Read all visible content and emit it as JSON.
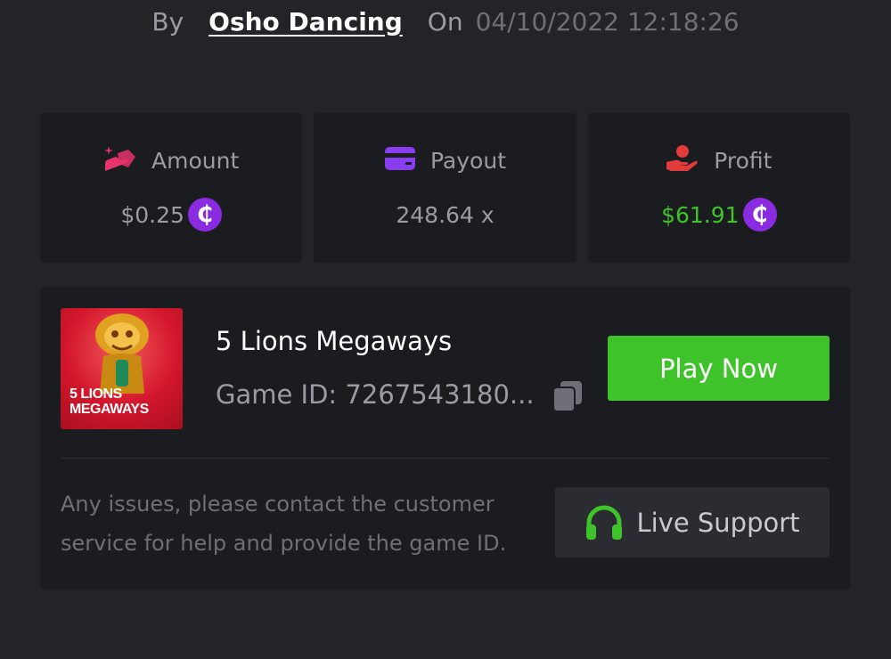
{
  "meta": {
    "by_label": "By",
    "username": "Osho Dancing",
    "on_label": "On",
    "timestamp": "04/10/2022 12:18:26"
  },
  "stats": {
    "amount": {
      "label": "Amount",
      "value": "$0.25",
      "icon": "amount-icon",
      "icon_color": "#e8336d"
    },
    "payout": {
      "label": "Payout",
      "value": "248.64 x",
      "icon": "wallet-icon",
      "icon_color": "#8a3cf0"
    },
    "profit": {
      "label": "Profit",
      "value": "$61.91",
      "icon": "hand-coin-icon",
      "icon_color": "#e23b3b",
      "value_color": "#3fc32a"
    },
    "coin_symbol": "₵",
    "coin_color": "#8a2be2"
  },
  "game": {
    "thumbnail_text_line1": "5 LIONS",
    "thumbnail_text_line2": "MEGAWAYS",
    "title": "5 Lions Megaways",
    "game_id": "Game ID: 7267543180...",
    "play_label": "Play Now",
    "play_color": "#3fc32a"
  },
  "support": {
    "help_text": "Any issues, please contact the customer service for help and provide the game ID.",
    "button_label": "Live Support",
    "icon": "headset-icon",
    "icon_color": "#3fc32a"
  }
}
